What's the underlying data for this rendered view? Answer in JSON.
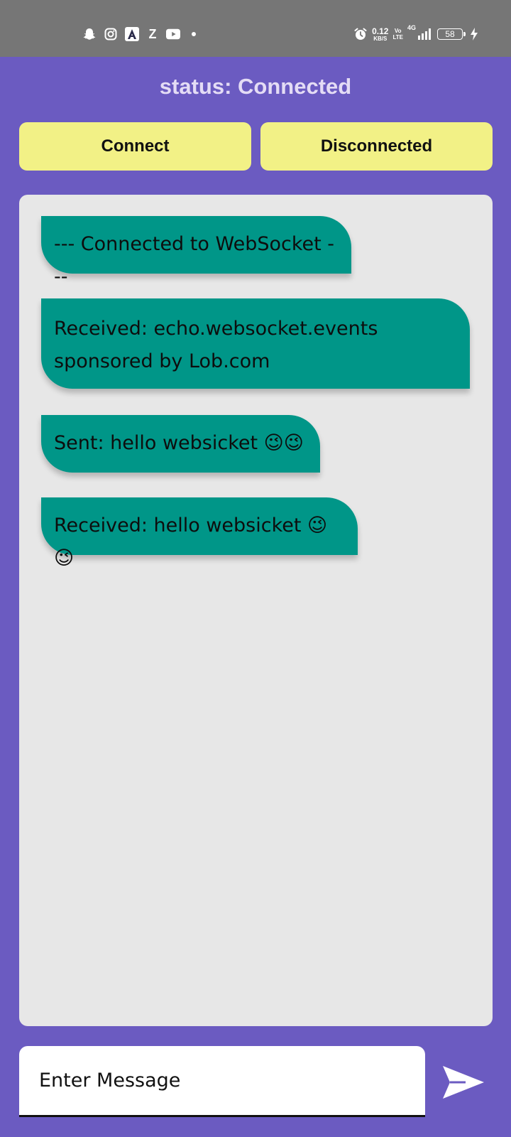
{
  "status_bar": {
    "left_icons": [
      "snapchat-icon",
      "instagram-icon",
      "arc-app-icon",
      "z-app-icon",
      "youtube-icon",
      "notification-dot"
    ],
    "z_letter": "Z",
    "net_speed_value": "0.12",
    "net_speed_unit": "KB/S",
    "volte_top": "Vo",
    "volte_bottom": "LTE",
    "network_type": "4G",
    "battery_level": "58",
    "right_icons": [
      "alarm-icon",
      "signal-icon",
      "battery-icon",
      "charging-icon"
    ]
  },
  "header": {
    "status_text": "status: Connected"
  },
  "buttons": {
    "connect_label": "Connect",
    "disconnect_label": "Disconnected"
  },
  "messages": [
    {
      "text": "--- Connected to WebSocket ---"
    },
    {
      "text": "Received: echo.websocket.events sponsored by Lob.com"
    },
    {
      "text": "Sent: hello websicket 😉😉"
    },
    {
      "text": "Received: hello websicket 😉😉"
    }
  ],
  "composer": {
    "placeholder": "Enter Message",
    "value": ""
  },
  "colors": {
    "background": "#6b5bc1",
    "status_bar": "#767676",
    "button": "#f2f186",
    "panel": "#e7e7e7",
    "bubble": "#009688",
    "title": "#e4dcf5"
  }
}
